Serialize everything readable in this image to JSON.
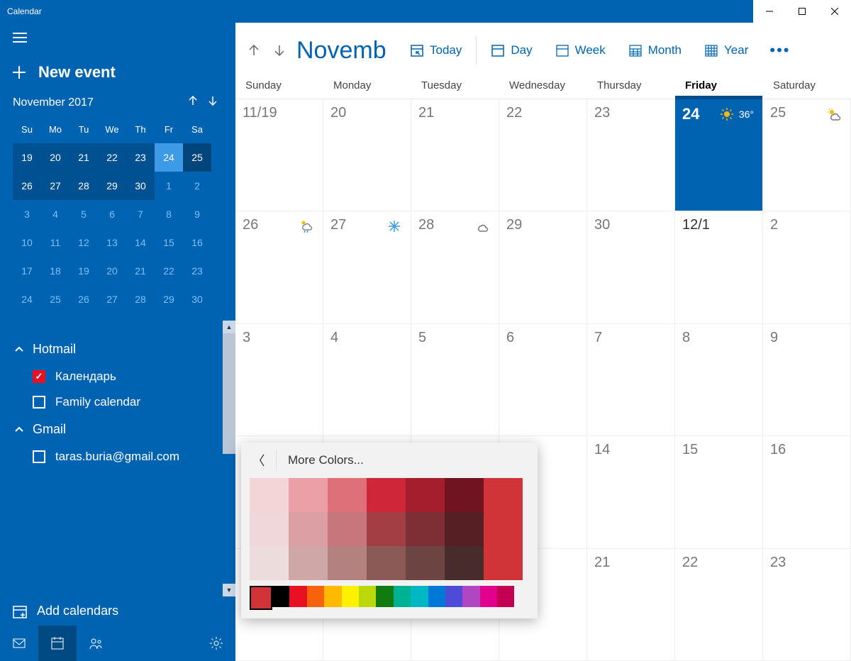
{
  "window": {
    "title": "Calendar"
  },
  "sidebar": {
    "new_event": "New event",
    "mini_month": "November 2017",
    "mini_days": [
      "Su",
      "Mo",
      "Tu",
      "We",
      "Th",
      "Fr",
      "Sa"
    ],
    "mini_cells": [
      {
        "n": "19",
        "cls": "inmonth"
      },
      {
        "n": "20",
        "cls": "inmonth"
      },
      {
        "n": "21",
        "cls": "inmonth"
      },
      {
        "n": "22",
        "cls": "inmonth"
      },
      {
        "n": "23",
        "cls": "inmonth"
      },
      {
        "n": "24",
        "cls": "inmonth selected"
      },
      {
        "n": "25",
        "cls": "inmonth adjacent"
      },
      {
        "n": "26",
        "cls": "inmonth"
      },
      {
        "n": "27",
        "cls": "inmonth"
      },
      {
        "n": "28",
        "cls": "inmonth"
      },
      {
        "n": "29",
        "cls": "inmonth"
      },
      {
        "n": "30",
        "cls": "inmonth"
      },
      {
        "n": "1",
        "cls": "outmonth"
      },
      {
        "n": "2",
        "cls": "outmonth"
      },
      {
        "n": "3",
        "cls": "outmonth"
      },
      {
        "n": "4",
        "cls": "outmonth"
      },
      {
        "n": "5",
        "cls": "outmonth"
      },
      {
        "n": "6",
        "cls": "outmonth"
      },
      {
        "n": "7",
        "cls": "outmonth"
      },
      {
        "n": "8",
        "cls": "outmonth"
      },
      {
        "n": "9",
        "cls": "outmonth"
      },
      {
        "n": "10",
        "cls": "outmonth"
      },
      {
        "n": "11",
        "cls": "outmonth"
      },
      {
        "n": "12",
        "cls": "outmonth"
      },
      {
        "n": "13",
        "cls": "outmonth"
      },
      {
        "n": "14",
        "cls": "outmonth"
      },
      {
        "n": "15",
        "cls": "outmonth"
      },
      {
        "n": "16",
        "cls": "outmonth"
      },
      {
        "n": "17",
        "cls": "outmonth"
      },
      {
        "n": "18",
        "cls": "outmonth"
      },
      {
        "n": "19",
        "cls": "outmonth"
      },
      {
        "n": "20",
        "cls": "outmonth"
      },
      {
        "n": "21",
        "cls": "outmonth"
      },
      {
        "n": "22",
        "cls": "outmonth"
      },
      {
        "n": "23",
        "cls": "outmonth"
      },
      {
        "n": "24",
        "cls": "outmonth"
      },
      {
        "n": "25",
        "cls": "outmonth"
      },
      {
        "n": "26",
        "cls": "outmonth"
      },
      {
        "n": "27",
        "cls": "outmonth"
      },
      {
        "n": "28",
        "cls": "outmonth"
      },
      {
        "n": "29",
        "cls": "outmonth"
      },
      {
        "n": "30",
        "cls": "outmonth"
      }
    ],
    "accounts": [
      {
        "name": "Hotmail",
        "cals": [
          {
            "label": "Календарь",
            "checked": true
          },
          {
            "label": "Family calendar",
            "checked": false
          }
        ]
      },
      {
        "name": "Gmail",
        "cals": [
          {
            "label": "taras.buria@gmail.com",
            "checked": false
          }
        ]
      }
    ],
    "add_calendars": "Add calendars"
  },
  "toolbar": {
    "month": "Novemb",
    "today": "Today",
    "views": {
      "day": "Day",
      "week": "Week",
      "month": "Month",
      "year": "Year"
    }
  },
  "day_headers": [
    "Sunday",
    "Monday",
    "Tuesday",
    "Wednesday",
    "Thursday",
    "Friday",
    "Saturday"
  ],
  "today_index": 5,
  "grid": [
    [
      {
        "n": "11/19"
      },
      {
        "n": "20"
      },
      {
        "n": "21"
      },
      {
        "n": "22"
      },
      {
        "n": "23"
      },
      {
        "n": "24",
        "today": true,
        "wx": "sun",
        "temp": "36°"
      },
      {
        "n": "25",
        "wx": "partly"
      }
    ],
    [
      {
        "n": "26",
        "wx": "rain"
      },
      {
        "n": "27",
        "wx": "snow"
      },
      {
        "n": "28",
        "wx": "cloud"
      },
      {
        "n": "29"
      },
      {
        "n": "30"
      },
      {
        "n": "12/1",
        "bold": true
      },
      {
        "n": "2"
      }
    ],
    [
      {
        "n": "3"
      },
      {
        "n": "4"
      },
      {
        "n": "5"
      },
      {
        "n": "6"
      },
      {
        "n": "7"
      },
      {
        "n": "8"
      },
      {
        "n": "9"
      }
    ],
    [
      {
        "n": ""
      },
      {
        "n": ""
      },
      {
        "n": ""
      },
      {
        "n": ""
      },
      {
        "n": "14"
      },
      {
        "n": "15"
      },
      {
        "n": "16"
      }
    ],
    [
      {
        "n": ""
      },
      {
        "n": ""
      },
      {
        "n": ""
      },
      {
        "n": ""
      },
      {
        "n": "21"
      },
      {
        "n": "22"
      },
      {
        "n": "23"
      }
    ]
  ],
  "colorpop": {
    "title": "More Colors...",
    "shades": [
      [
        "#f3d4d7",
        "#eaa0a6",
        "#dd7079",
        "#cf2639",
        "#a51e2e",
        "#6f1420"
      ],
      [
        "#f0d8da",
        "#dca0a4",
        "#c7767b",
        "#a33e44",
        "#7e2f35",
        "#551f24"
      ],
      [
        "#ecdcdc",
        "#cfa7a7",
        "#b3817f",
        "#8c5a56",
        "#6c4442",
        "#472c2b"
      ]
    ],
    "big": "#d13438",
    "hues": [
      "#d13438",
      "#000000",
      "#e81123",
      "#f7630c",
      "#ffb900",
      "#fff100",
      "#bad80a",
      "#107c10",
      "#00b294",
      "#00b7c3",
      "#0078d7",
      "#4f4bd9",
      "#b146c2",
      "#e3008c",
      "#c30052"
    ]
  }
}
